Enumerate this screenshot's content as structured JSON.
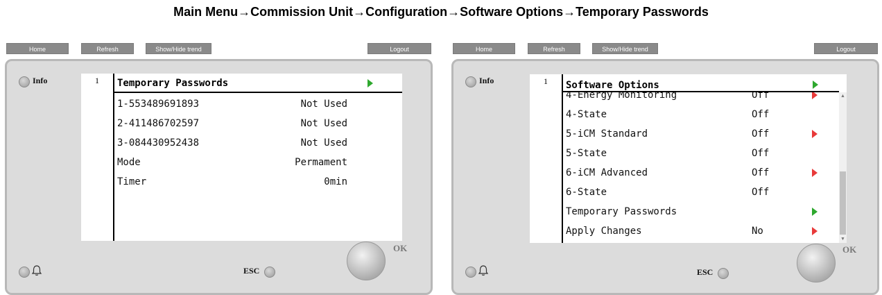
{
  "caption": "Main Menu→Commission Unit→Configuration→Software Options→Temporary Passwords",
  "toolbar": {
    "home_label": "Home",
    "refresh_label": "Refresh",
    "trend_label": "Show/Hide trend",
    "logout_label": "Logout"
  },
  "controls": {
    "info_label": "Info",
    "esc_label": "ESC",
    "ok_label": "OK"
  },
  "left_screen": {
    "page_number": "1",
    "title": "Temporary Passwords",
    "rows": [
      {
        "label": "1-553489691893",
        "value": "Not Used"
      },
      {
        "label": "2-411486702597",
        "value": "Not Used"
      },
      {
        "label": "3-084430952438",
        "value": "Not Used"
      },
      {
        "label": "Mode",
        "value": "Permament"
      },
      {
        "label": "Timer",
        "value": "0min"
      }
    ]
  },
  "right_screen": {
    "page_number": "1",
    "title": "Software Options",
    "rows": [
      {
        "label": "4-Energy Monitoring",
        "value": "Off",
        "arrow": "red"
      },
      {
        "label": "4-State",
        "value": "Off",
        "arrow": ""
      },
      {
        "label": "5-iCM Standard",
        "value": "Off",
        "arrow": "red"
      },
      {
        "label": "5-State",
        "value": "Off",
        "arrow": ""
      },
      {
        "label": "6-iCM Advanced",
        "value": "Off",
        "arrow": "red"
      },
      {
        "label": "6-State",
        "value": "Off",
        "arrow": ""
      },
      {
        "label": "Temporary Passwords",
        "value": "",
        "arrow": "green"
      },
      {
        "label": "Apply Changes",
        "value": "No",
        "arrow": "red"
      }
    ]
  },
  "colors": {
    "arrow_green": "#2ea82e",
    "arrow_red": "#e83a3a",
    "toolbar_button": "#8a8a8a",
    "device_body": "#dcdcdc"
  }
}
